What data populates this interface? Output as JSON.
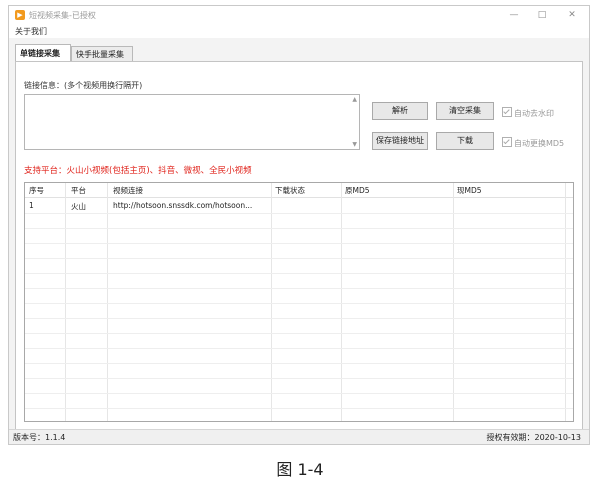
{
  "window": {
    "title": "短视频采集-已授权",
    "icon": "play-icon",
    "controls": {
      "minimize": "—",
      "maximize": "□",
      "close": "✕"
    }
  },
  "menu": {
    "items": [
      "关于我们"
    ]
  },
  "tabs": [
    {
      "label": "单链接采集",
      "active": true
    },
    {
      "label": "快手批量采集",
      "active": false
    }
  ],
  "link_section": {
    "label": "链接信息：(多个视频用换行隔开)",
    "value": ""
  },
  "buttons": {
    "parse": "解析",
    "clear": "清空采集",
    "save_link": "保存链接地址",
    "download": "下载"
  },
  "options": {
    "auto_watermark": {
      "label": "自动去水印",
      "checked": true
    },
    "auto_md5": {
      "label": "自动更换MD5",
      "checked": true
    }
  },
  "support_text": "支持平台：火山小视频(包括主页)、抖音、微视、全民小视频",
  "table": {
    "headers": [
      "序号",
      "平台",
      "视频连接",
      "下载状态",
      "原MD5",
      "现MD5"
    ],
    "rows": [
      [
        "1",
        "火山",
        "http://hotsoon.snssdk.com/hotsoon...",
        "",
        "",
        ""
      ]
    ]
  },
  "status": {
    "version": "版本号：1.1.4",
    "license": "授权有效期：2020-10-13"
  },
  "caption": "图 1-4",
  "colors": {
    "accent": "#f29a1e",
    "support_red": "#e0231b"
  }
}
